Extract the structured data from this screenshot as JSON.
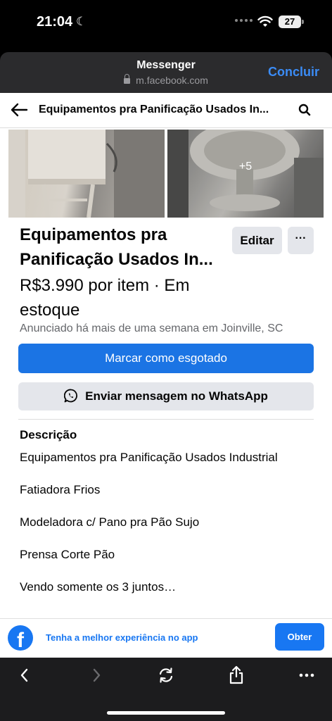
{
  "status_bar": {
    "time": "21:04",
    "battery": "27"
  },
  "sheet": {
    "title": "Messenger",
    "url": "m.facebook.com",
    "done_label": "Concluir"
  },
  "topbar": {
    "title": "Equipamentos pra Panificação Usados In..."
  },
  "photos": {
    "more_count": "+5"
  },
  "listing": {
    "title_line1": "Equipamentos pra",
    "title_line2": "Panificação Usados In...",
    "edit_label": "Editar",
    "more_label": "···",
    "price_line1": "R$3.990 por item · Em",
    "price_line2": "estoque",
    "posted": "Anunciado há mais de uma semana em Joinville, SC",
    "mark_sold_label": "Marcar como esgotado",
    "whatsapp_label": "Enviar mensagem no WhatsApp"
  },
  "description": {
    "heading": "Descrição",
    "lines": [
      "Equipamentos pra Panificação Usados Industrial",
      "Fatiadora Frios",
      "Modeladora c/ Pano pra Pão Sujo",
      "Prensa Corte Pão",
      "Vendo somente os 3 juntos…"
    ]
  },
  "app_banner": {
    "text": "Tenha a melhor experiência no app",
    "button": "Obter"
  },
  "icons": {
    "back": "back-arrow-icon",
    "search": "search-icon",
    "whatsapp": "whatsapp-icon",
    "lock": "lock-icon",
    "facebook": "facebook-logo",
    "nav_back": "chevron-left-icon",
    "nav_forward": "chevron-right-icon",
    "reload": "reload-icon",
    "share": "share-icon",
    "more": "more-icon"
  },
  "colors": {
    "primary": "#1b74e4",
    "sheet_header": "#2b2b2d",
    "done": "#3b8cf6"
  }
}
